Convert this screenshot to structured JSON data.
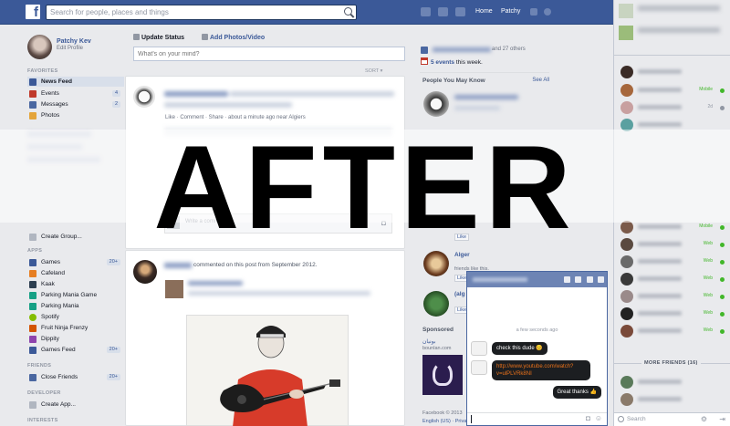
{
  "topbar": {
    "search_placeholder": "Search for people, places and things",
    "nav_home": "Home",
    "nav_profile": "Patchy"
  },
  "profile": {
    "name": "Patchy Kev",
    "edit": "Edit Profile"
  },
  "favorites": {
    "title": "FAVORITES",
    "items": [
      {
        "label": "News Feed",
        "count": ""
      },
      {
        "label": "Events",
        "count": "4"
      },
      {
        "label": "Messages",
        "count": "2"
      },
      {
        "label": "Photos",
        "count": ""
      }
    ]
  },
  "groups_hint": {
    "label": "Create Group..."
  },
  "apps": {
    "title": "APPS",
    "items": [
      {
        "label": "Games",
        "count": "20+"
      },
      {
        "label": "Cafeland",
        "count": ""
      },
      {
        "label": "Kaak",
        "count": ""
      },
      {
        "label": "Parking Mania Game",
        "count": ""
      },
      {
        "label": "Parking Mania",
        "count": ""
      },
      {
        "label": "Spotify",
        "count": ""
      },
      {
        "label": "Fruit Ninja Frenzy",
        "count": ""
      },
      {
        "label": "Dippity",
        "count": ""
      },
      {
        "label": "Games Feed",
        "count": "20+"
      }
    ]
  },
  "friends": {
    "title": "FRIENDS",
    "items": [
      {
        "label": "Close Friends",
        "count": "20+"
      }
    ]
  },
  "developer": {
    "title": "DEVELOPER",
    "items": [
      {
        "label": "Create App..."
      }
    ]
  },
  "interests": {
    "title": "INTERESTS"
  },
  "composer": {
    "update_status": "Update Status",
    "add_photos": "Add Photos/Video",
    "placeholder": "What's on your mind?",
    "sort": "SORT ▾"
  },
  "post1": {
    "meta": "Like · Comment · Share · about a minute ago near Algiers"
  },
  "post2": {
    "comment_placeholder": "Write a comment..."
  },
  "post3": {
    "action": "commented on this post from September 2012."
  },
  "right": {
    "others": "and 27 others",
    "events_count": "5 events",
    "events_suffix": "this week.",
    "pymk_title": "People You May Know",
    "see_all": "See All",
    "suggest_name": "Alger",
    "suggest_name2": "(alg",
    "like_label": "Like",
    "friends_like": "friends like this.",
    "sponsored": "Sponsored",
    "ad_url": "bounlan.com",
    "footer": "Facebook © 2013",
    "lang": "English (US) · Privacy"
  },
  "chat": {
    "statuses": [
      "Mobile",
      "Web",
      "Web",
      "Web",
      "Web",
      "Mobile",
      "Web",
      "Web",
      "Web",
      "Web",
      "Web",
      "Web"
    ],
    "more_friends": "MORE FRIENDS (16)",
    "search": "Search"
  },
  "chat_window": {
    "time": "a few seconds ago",
    "msg1": "check this dude 😊",
    "msg2_line1": "http://www.youtube.com/watch?",
    "msg2_line2": "v=ulPLVRk8NI",
    "msg3": "Great thanks 👍"
  },
  "overlay": {
    "text": "AFTER"
  },
  "colors": {
    "brand": "#3b5998",
    "link": "#3b5998",
    "online": "#42b72a",
    "youtube_link": "#e8711a"
  }
}
